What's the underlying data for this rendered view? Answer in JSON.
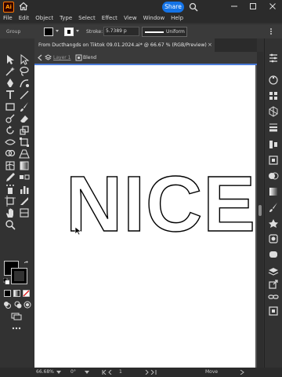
{
  "app": {
    "logo_text": "Ai"
  },
  "titlebar": {
    "share_label": "Share"
  },
  "menu": [
    "File",
    "Edit",
    "Object",
    "Type",
    "Select",
    "Effect",
    "View",
    "Window",
    "Help"
  ],
  "control": {
    "group_label": "Group",
    "stroke_label": "Stroke:",
    "stroke_value": "5.7389 p",
    "profile_label": "Uniform"
  },
  "document": {
    "tab_title": "From Ducthangds on Tiktok 09.01.2024.ai* @ 66.67 % (RGB/Preview)",
    "close_label": "×",
    "layer_label": "Layer 1",
    "group_label": "Blend"
  },
  "canvas": {
    "art_text": "NICE"
  },
  "status": {
    "zoom": "66.68%",
    "rotation": "0°",
    "artboard_number": "1",
    "tool_hint": "Move"
  },
  "colors": {
    "accent": "#1473e6",
    "selection_bar": "#4b7bd8",
    "logo": "#ff9a00"
  }
}
